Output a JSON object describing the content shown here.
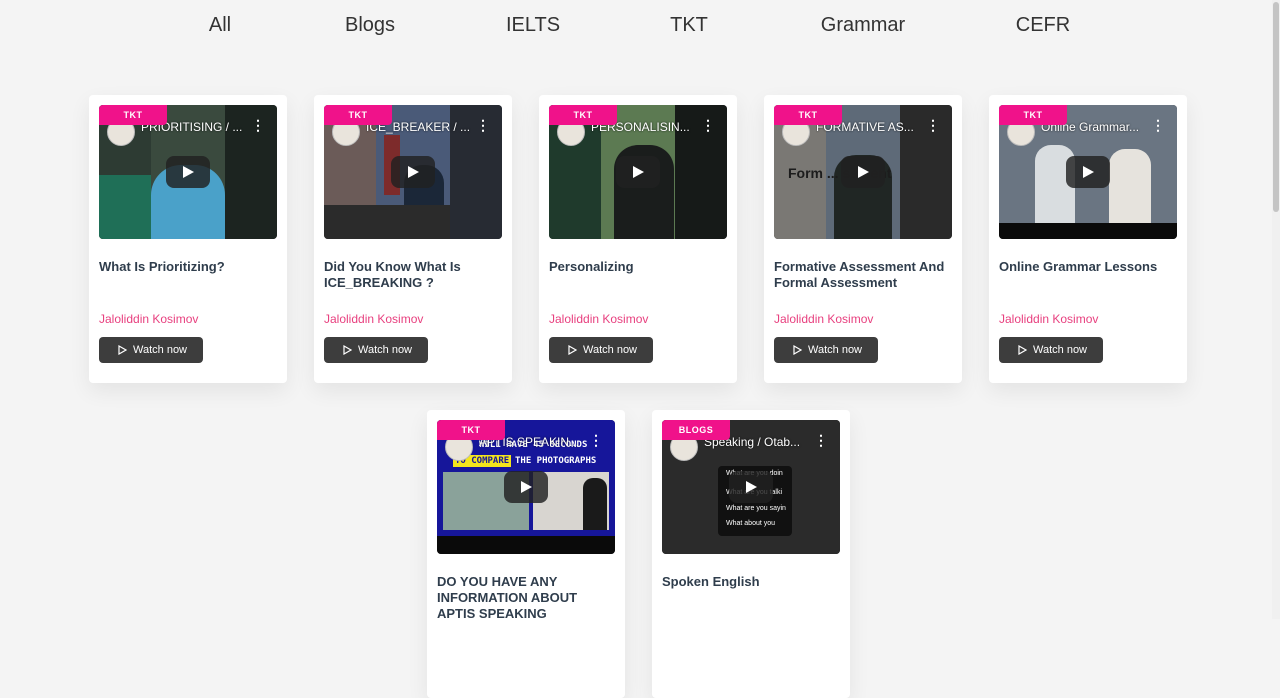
{
  "tabs": [
    "All",
    "Blogs",
    "IELTS",
    "TKT",
    "Grammar",
    "CEFR"
  ],
  "watch_label": "Watch now",
  "colors": {
    "badge": "#f0128a",
    "author": "#e8407f",
    "button": "#3d3d3d",
    "background": "#f4f4f4"
  },
  "cards": [
    {
      "badge": "TKT",
      "video_title": "PRIORITISING / ...",
      "thumb_text": "",
      "title": "What Is Prioritizing?",
      "author": "Jaloliddin Kosimov"
    },
    {
      "badge": "TKT",
      "video_title": "ICE_BREAKER / ...",
      "thumb_text": "",
      "title": "Did You Know What Is ICE_BREAKING ?",
      "author": "Jaloliddin Kosimov"
    },
    {
      "badge": "TKT",
      "video_title": "PERSONALISIN...",
      "thumb_text": "",
      "title": "Personalizing",
      "author": "Jaloliddin Kosimov"
    },
    {
      "badge": "TKT",
      "video_title": "FORMATIVE AS...",
      "thumb_text": "Form ... ssment",
      "title": "Formative Assessment And Formal Assessment",
      "author": "Jaloliddin Kosimov"
    },
    {
      "badge": "TKT",
      "video_title": "Online Grammar...",
      "thumb_text": "",
      "title": "Online Grammar Lessons",
      "author": "Jaloliddin Kosimov"
    },
    {
      "badge": "TKT",
      "video_title": "APTIS SPEAKIN...",
      "thumb_text_lines": [
        "WILL HAVE 45 SECONDS",
        "TO COMPARE",
        "THE PHOTOGRAPHS"
      ],
      "title": "DO YOU HAVE ANY INFORMATION ABOUT APTIS SPEAKING",
      "author": ""
    },
    {
      "badge": "BLOGS",
      "video_title": "Speaking / Otab...",
      "thumb_text_lines": [
        "What are you doin",
        "What are you talki",
        "What are you sayin",
        "What about you"
      ],
      "title": "Spoken English",
      "author": ""
    }
  ]
}
